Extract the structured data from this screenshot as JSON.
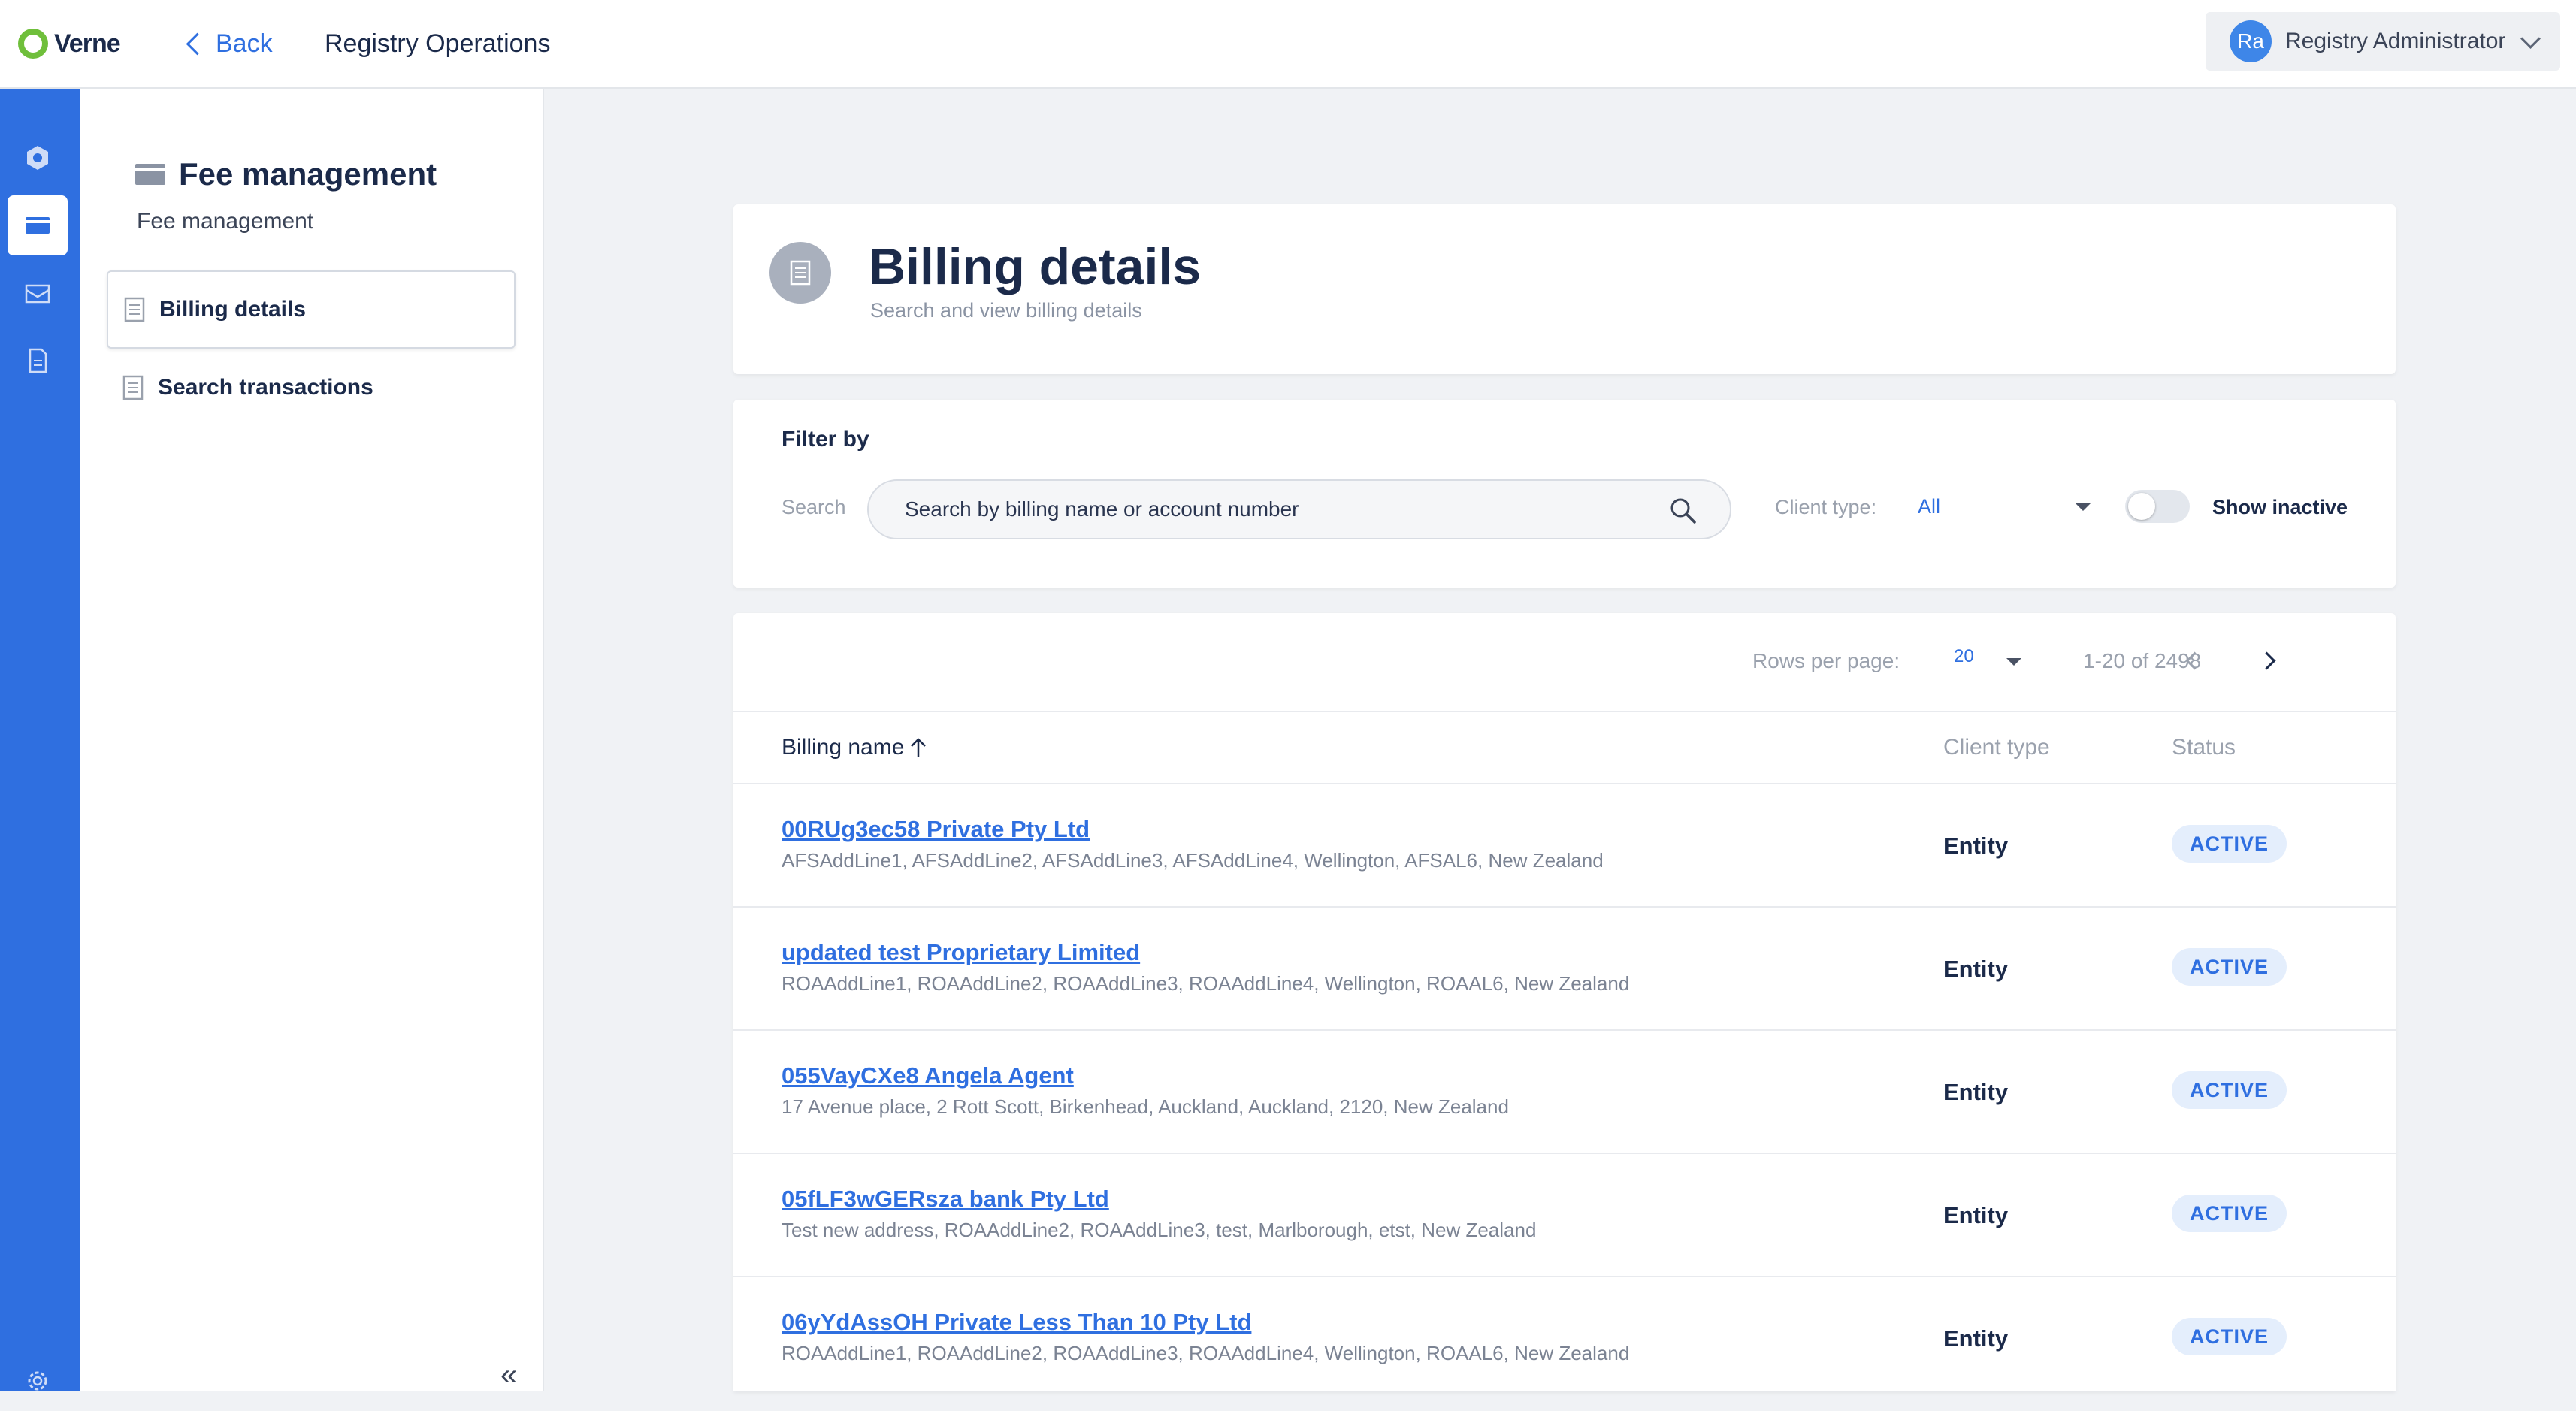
{
  "header": {
    "logo_text": "Verne",
    "back_label": "Back",
    "app_title": "Registry Operations",
    "user": {
      "initials": "Ra",
      "name": "Registry Administrator"
    }
  },
  "rail": {
    "items": [
      {
        "icon": "settings-hex-icon",
        "active": false
      },
      {
        "icon": "wallet-icon",
        "active": true
      },
      {
        "icon": "mail-icon",
        "active": false
      },
      {
        "icon": "document-icon",
        "active": false
      }
    ],
    "bottom_icon": "gear-icon"
  },
  "subnav": {
    "title": "Fee management",
    "subtitle": "Fee management",
    "items": [
      {
        "label": "Billing details",
        "icon": "document-list-icon",
        "active": true
      },
      {
        "label": "Search transactions",
        "icon": "document-list-icon",
        "active": false
      }
    ],
    "collapse_icon": "chevron-double-left-icon"
  },
  "page": {
    "title": "Billing details",
    "subtitle": "Search and view billing details"
  },
  "filters": {
    "heading": "Filter by",
    "search_label": "Search",
    "search_placeholder": "Search by billing name or account number",
    "client_type_label": "Client type:",
    "client_type_value": "All",
    "show_inactive_label": "Show inactive",
    "show_inactive_on": false
  },
  "pagination": {
    "rows_per_page_label": "Rows per page:",
    "rows_per_page": "20",
    "range": "1-20 of 2498"
  },
  "table": {
    "columns": [
      "Billing name",
      "Client type",
      "Status"
    ],
    "rows": [
      {
        "name": "00RUg3ec58 Private Pty Ltd",
        "address": "AFSAddLine1, AFSAddLine2, AFSAddLine3, AFSAddLine4, Wellington, AFSAL6, New Zealand",
        "client_type": "Entity",
        "status": "ACTIVE"
      },
      {
        "name": "updated test Proprietary Limited",
        "address": "ROAAddLine1, ROAAddLine2, ROAAddLine3, ROAAddLine4, Wellington, ROAAL6, New Zealand",
        "client_type": "Entity",
        "status": "ACTIVE"
      },
      {
        "name": "055VayCXe8 Angela Agent",
        "address": "17 Avenue place, 2 Rott Scott, Birkenhead, Auckland, Auckland, 2120, New Zealand",
        "client_type": "Entity",
        "status": "ACTIVE"
      },
      {
        "name": "05fLF3wGERsza bank Pty Ltd",
        "address": "Test new address, ROAAddLine2, ROAAddLine3, test, Marlborough, etst, New Zealand",
        "client_type": "Entity",
        "status": "ACTIVE"
      },
      {
        "name": "06yYdAssOH Private Less Than 10 Pty Ltd",
        "address": "ROAAddLine1, ROAAddLine2, ROAAddLine3, ROAAddLine4, Wellington, ROAAL6, New Zealand",
        "client_type": "Entity",
        "status": "ACTIVE"
      }
    ]
  },
  "colors": {
    "accent": "#2f6fe0",
    "rail": "#2f6fe0",
    "text_dark": "#1b2a4a",
    "badge_bg": "#e4eefc"
  }
}
